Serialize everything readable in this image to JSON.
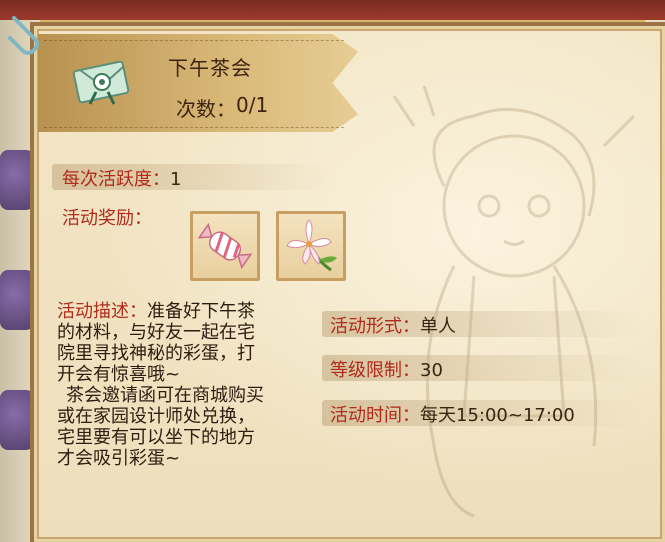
{
  "event": {
    "title": "下午茶会",
    "count_label": "次数：",
    "count_value": "0/1"
  },
  "activity": {
    "label": "每次活跃度：",
    "value": "1"
  },
  "rewards": {
    "label": "活动奖励：",
    "items": [
      {
        "icon": "candy-icon"
      },
      {
        "icon": "lily-flower-icon"
      }
    ]
  },
  "description": {
    "label": "活动描述：",
    "line1": "准备好下午茶",
    "line2": "的材料，与好友一起在宅",
    "line3": "院里寻找神秘的彩蛋，打",
    "line4": "开会有惊喜哦~",
    "line5": "茶会邀请函可在商城购买",
    "line6": "或在家园设计师处兑换，",
    "line7": "宅里要有可以坐下的地方",
    "line8": "才会吸引彩蛋~"
  },
  "details": {
    "form_label": "活动形式：",
    "form_value": "单人",
    "level_label": "等级限制：",
    "level_value": "30",
    "time_label": "活动时间：",
    "time_value": "每天15:00~17:00"
  },
  "colors": {
    "label": "#b22a1a",
    "text": "#3b2412",
    "panel": "#f3e6c6",
    "border": "#9a7447"
  }
}
